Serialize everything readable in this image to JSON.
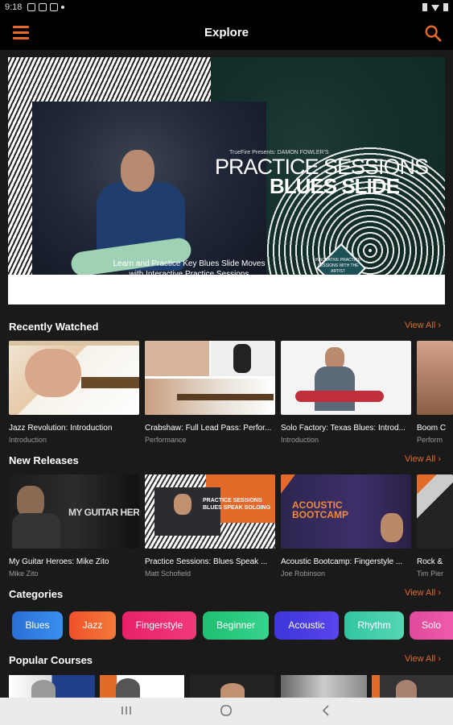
{
  "status_bar": {
    "time": "9:18"
  },
  "app_bar": {
    "title": "Explore"
  },
  "hero": {
    "presenter": "TrueFire Presents: DAMON FOWLER'S",
    "title_line1": "PRACTICE SESSIONS",
    "title_line2": "BLUES SLIDE",
    "caption_line1": "Learn and Practice Key Blues Slide Moves",
    "caption_line2": "with Interactive Practice Sessions",
    "badge": "INNOVATIVE PRACTICE SESSIONS WITH THE ARTIST"
  },
  "recently_watched": {
    "title": "Recently Watched",
    "view_all": "View All",
    "items": [
      {
        "title": "Jazz Revolution: Introduction",
        "subtitle": "Introduction"
      },
      {
        "title": "Crabshaw: Full Lead Pass: Perfor...",
        "subtitle": "Performance"
      },
      {
        "title": "Solo Factory: Texas Blues: Introd...",
        "subtitle": "Introduction"
      },
      {
        "title": "Boom C",
        "subtitle": "Perform"
      }
    ]
  },
  "new_releases": {
    "title": "New Releases",
    "view_all": "View All",
    "items": [
      {
        "title": "My Guitar Heroes: Mike Zito",
        "subtitle": "Mike Zito",
        "thumb_text": "MY GUITAR HEROES"
      },
      {
        "title": "Practice Sessions: Blues Speak ...",
        "subtitle": "Matt Schofield",
        "thumb_text": "PRACTICE SESSIONS BLUES SPEAK SOLOING"
      },
      {
        "title": "Acoustic Bootcamp: Fingerstyle ...",
        "subtitle": "Joe Robinson",
        "thumb_text": "ACOUSTIC BOOTCAMP"
      },
      {
        "title": "Rock &",
        "subtitle": "Tim Pier"
      }
    ]
  },
  "categories": {
    "title": "Categories",
    "view_all": "View All",
    "chips": [
      {
        "label": "Blues",
        "color": "#2f7de1"
      },
      {
        "label": "Jazz",
        "color": "#f0632b"
      },
      {
        "label": "Fingerstyle",
        "color": "#e8266d"
      },
      {
        "label": "Beginner",
        "color": "#22c47b"
      },
      {
        "label": "Acoustic",
        "color": "#4b3fe0"
      },
      {
        "label": "Rhythm",
        "color": "#3ec7a8"
      },
      {
        "label": "Solo",
        "color": "#e84aa0"
      }
    ]
  },
  "popular_courses": {
    "title": "Popular Courses",
    "view_all": "View All"
  },
  "colors": {
    "accent": "#e4692a",
    "background": "#1a1a1a"
  }
}
